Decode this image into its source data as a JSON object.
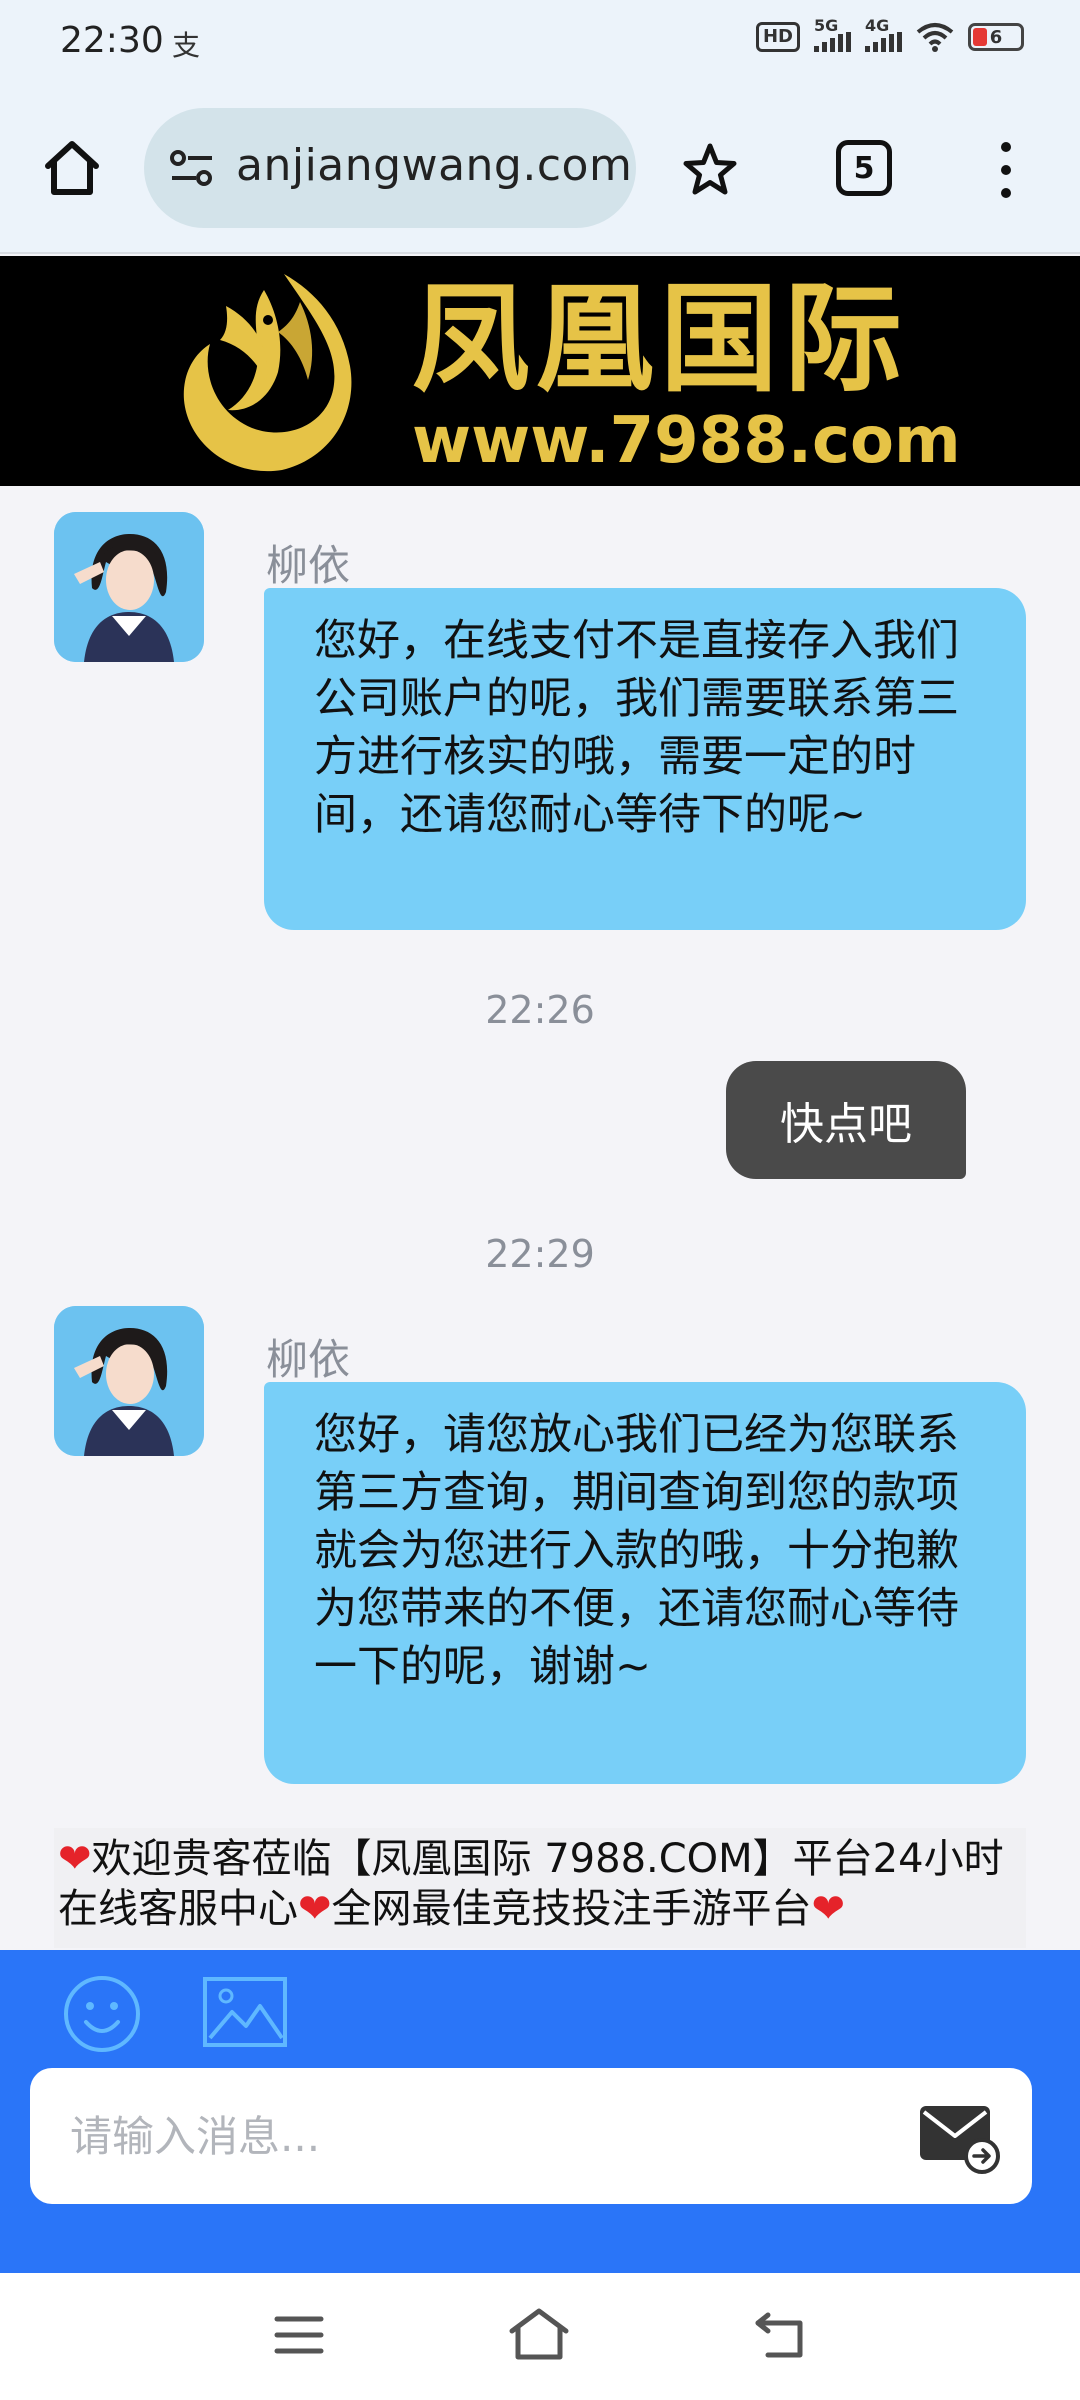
{
  "status_bar": {
    "time": "22:30",
    "notification_icon": "支",
    "hd_badge": "HD",
    "network_1": "5G",
    "network_2": "4G",
    "battery_level": "6"
  },
  "browser": {
    "url": "anjiangwang.com",
    "tab_count": "5"
  },
  "banner": {
    "brand_name": "凤凰国际",
    "site": "www.7988.com"
  },
  "chat": {
    "messages": [
      {
        "sender": "柳依",
        "text": "您好，在线支付不是直接存入我们公司账户的呢，我们需要联系第三方进行核实的哦，需要一定的时间，还请您耐心等待下的呢~"
      },
      {
        "timestamp": "22:26"
      },
      {
        "text": "快点吧"
      },
      {
        "timestamp": "22:29"
      },
      {
        "sender": "柳依",
        "text": "您好，请您放心我们已经为您联系第三方查询，期间查询到您的款项就会为您进行入款的哦，十分抱歉为您带来的不便，还请您耐心等待一下的呢，谢谢~"
      }
    ]
  },
  "notice": {
    "part1": "欢迎贵客莅临【凤凰国际 7988.COM】平台24小时在线客服中心",
    "part2": "全网最佳竞技投注手游平台"
  },
  "input": {
    "placeholder": "请输入消息..."
  },
  "colors": {
    "incoming_bubble": "#78cff8",
    "outgoing_bubble": "#4a4a4a",
    "input_bar": "#2a75f8",
    "brand_gold": "#e6c347"
  },
  "icons": [
    "home-icon",
    "site-settings-icon",
    "star-icon",
    "tabs-icon",
    "more-icon",
    "emoji-icon",
    "image-icon",
    "send-mail-icon",
    "heart-icon",
    "nav-menu-icon",
    "nav-home-icon",
    "nav-back-icon"
  ]
}
